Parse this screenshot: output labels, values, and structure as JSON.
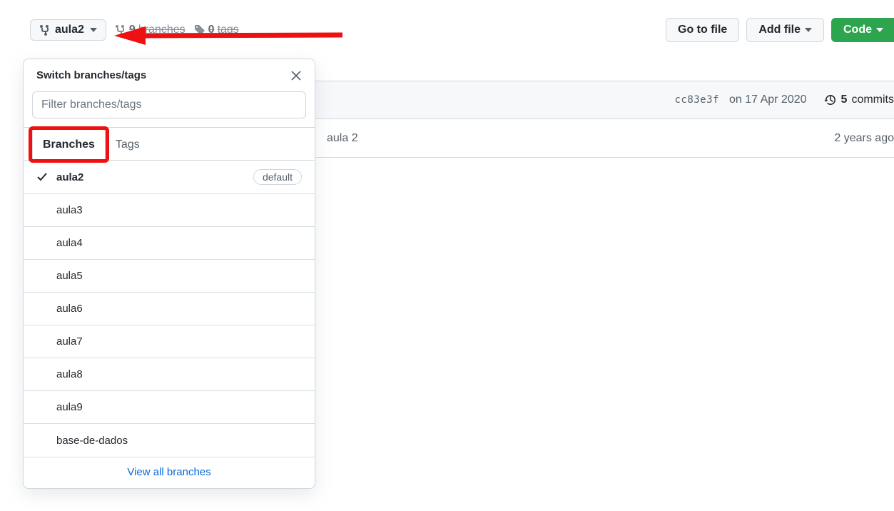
{
  "branch_button": {
    "name": "aula2"
  },
  "stats": {
    "branches_count": "9",
    "branches_label": "branches",
    "tags_count": "0",
    "tags_label": "tags"
  },
  "toolbar": {
    "go_to_file": "Go to file",
    "add_file": "Add file",
    "code": "Code"
  },
  "commit_bar": {
    "sha": "cc83e3f",
    "date": "on 17 Apr 2020",
    "commits_count": "5",
    "commits_label": "commits"
  },
  "file_row": {
    "message": "aula 2",
    "age": "2 years ago"
  },
  "dropdown": {
    "title": "Switch branches/tags",
    "filter_placeholder": "Filter branches/tags",
    "tab_branches": "Branches",
    "tab_tags": "Tags",
    "default_label": "default",
    "branches": [
      {
        "name": "aula2",
        "current": true,
        "default": true
      },
      {
        "name": "aula3",
        "current": false,
        "default": false
      },
      {
        "name": "aula4",
        "current": false,
        "default": false
      },
      {
        "name": "aula5",
        "current": false,
        "default": false
      },
      {
        "name": "aula6",
        "current": false,
        "default": false
      },
      {
        "name": "aula7",
        "current": false,
        "default": false
      },
      {
        "name": "aula8",
        "current": false,
        "default": false
      },
      {
        "name": "aula9",
        "current": false,
        "default": false
      },
      {
        "name": "base-de-dados",
        "current": false,
        "default": false
      }
    ],
    "view_all": "View all branches"
  }
}
